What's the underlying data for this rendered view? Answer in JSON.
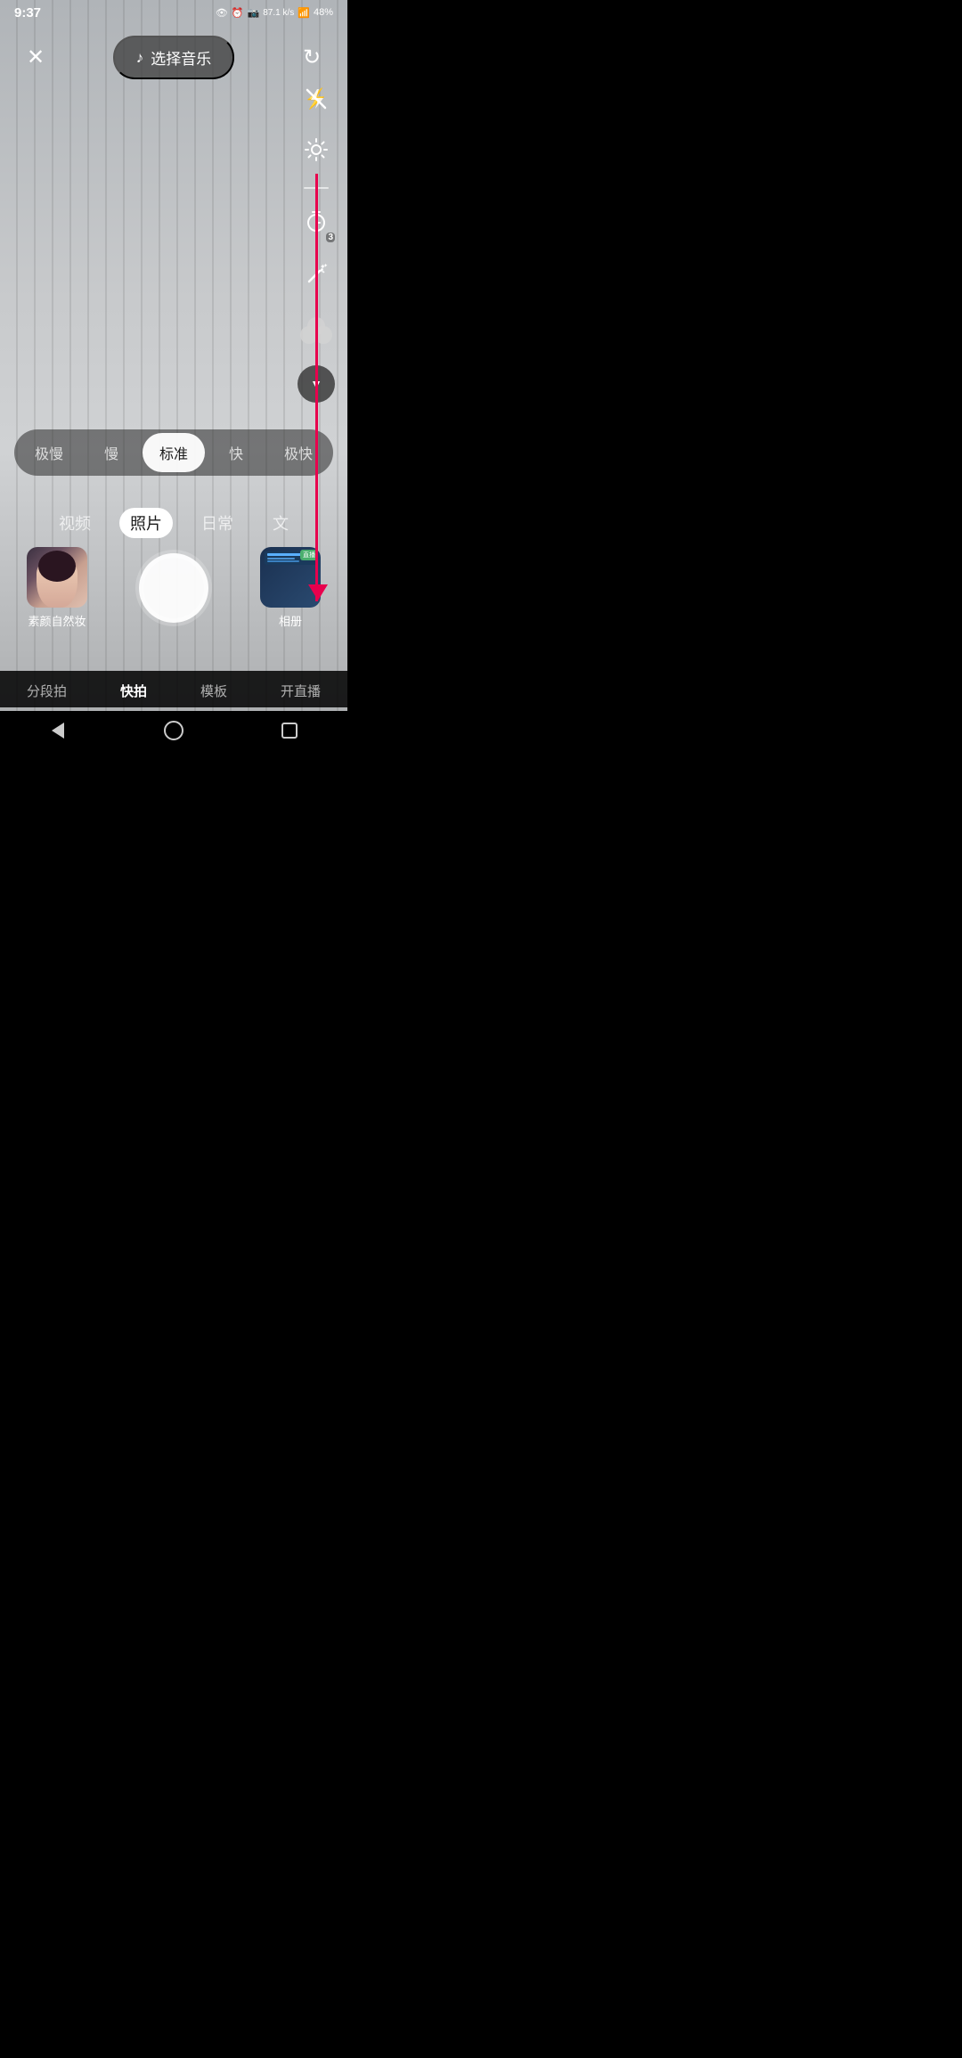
{
  "statusBar": {
    "time": "9:37",
    "battery": "48%",
    "signal": "87.1 k/s"
  },
  "topControls": {
    "closeLabel": "✕",
    "musicLabel": "选择音乐",
    "refreshLabel": "↻"
  },
  "rightTools": {
    "flashIcon": "flash-off",
    "settingsIcon": "settings",
    "timerIcon": "timer",
    "timerBadge": "3",
    "magicIcon": "magic-wand",
    "beautyIcon": "beauty-circles",
    "moreIcon": "chevron-down"
  },
  "speedSelector": {
    "items": [
      "极慢",
      "慢",
      "标准",
      "快",
      "极快"
    ],
    "activeIndex": 2
  },
  "modeTabs": {
    "items": [
      "视频",
      "照片",
      "日常",
      "文"
    ],
    "activeIndex": 1
  },
  "bottomControls": {
    "galleryLabel": "素颜自然妆",
    "albumLabel": "相册",
    "shutterLabel": ""
  },
  "bottomNav": {
    "items": [
      "分段拍",
      "快拍",
      "模板",
      "开直播"
    ],
    "activeIndex": 1
  },
  "redArrow": {
    "visible": true
  }
}
